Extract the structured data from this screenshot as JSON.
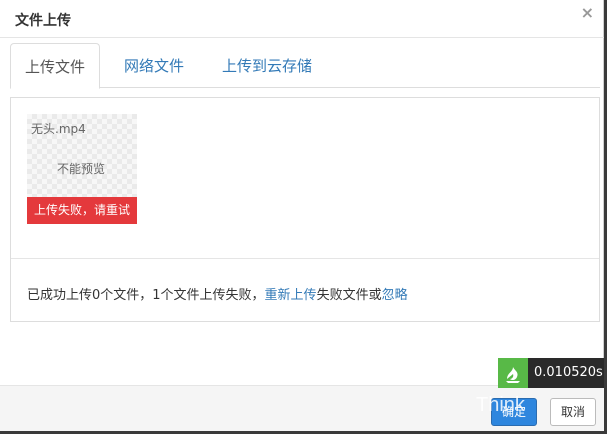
{
  "modal": {
    "title": "文件上传",
    "close_symbol": "×"
  },
  "tabs": [
    {
      "label": "上传文件",
      "active": true
    },
    {
      "label": "网络文件",
      "active": false
    },
    {
      "label": "上传到云存储",
      "active": false
    }
  ],
  "file": {
    "name": "无头.mp4",
    "preview_text": "不能预览",
    "error_text": "上传失败，请重试"
  },
  "status": {
    "prefix": "已成功上传0个文件，1个文件上传失败，",
    "retry_link": "重新上传",
    "middle": "失败文件或",
    "ignore_link": "忽略"
  },
  "footer": {
    "confirm_label": "确定",
    "cancel_label": "取消"
  },
  "debug": {
    "time": "0.010520s"
  },
  "watermark": "Think",
  "colors": {
    "error": "#e4393c",
    "link": "#337ab7",
    "primary": "#2e86de",
    "debug_green": "#58b947"
  }
}
